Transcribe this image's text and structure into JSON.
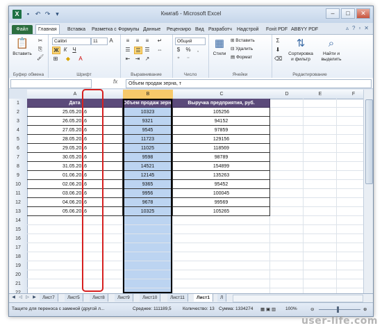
{
  "window": {
    "title": "Книга6 - Microsoft Excel",
    "app_icon": "X"
  },
  "tabs": [
    "Файл",
    "Главная",
    "Вставка",
    "Разметка с",
    "Формулы",
    "Данные",
    "Рецензиро",
    "Вид",
    "Разработч",
    "Надстрой",
    "Foxit PDF",
    "ABBYY PDF"
  ],
  "ribbon": {
    "paste": "Вставить",
    "font_name": "Calibri",
    "font_size": "11",
    "number_format": "Общий",
    "styles": "Стили",
    "insert": "Вставить",
    "delete": "Удалить",
    "format": "Формат",
    "sort_l1": "Сортировка",
    "sort_l2": "и фильтр",
    "find_l1": "Найти и",
    "find_l2": "выделить",
    "groups": {
      "clipboard": "Буфер обмена",
      "font": "Шрифт",
      "alignment": "Выравнивание",
      "number": "Число",
      "cells": "Ячейки",
      "editing": "Редактирование"
    },
    "bold": "Ж",
    "italic": "К",
    "underline": "Ч"
  },
  "formula_bar": {
    "name_box": "",
    "fx": "fx",
    "value": "Объем продаж зерна, т"
  },
  "columns": [
    "A",
    "B",
    "C",
    "D",
    "E",
    "F"
  ],
  "rows": [
    "1",
    "2",
    "3",
    "4",
    "5",
    "6",
    "7",
    "8",
    "9",
    "10",
    "11",
    "12",
    "13",
    "14",
    "15",
    "16",
    "17",
    "18",
    "19",
    "20",
    "21",
    "22",
    "23"
  ],
  "headers": [
    "Дата",
    "Объем продаж зерна, т",
    "Выручка предприятия, руб."
  ],
  "table": [
    [
      "25.05.2016",
      "10323",
      "105256"
    ],
    [
      "26.05.2016",
      "9321",
      "94152"
    ],
    [
      "27.05.2016",
      "9545",
      "97859"
    ],
    [
      "28.05.2016",
      "11723",
      "129156"
    ],
    [
      "29.05.2016",
      "11025",
      "118569"
    ],
    [
      "30.05.2016",
      "9598",
      "98789"
    ],
    [
      "31.05.2016",
      "14521",
      "154899"
    ],
    [
      "01.06.2016",
      "12145",
      "135263"
    ],
    [
      "02.06.2016",
      "9365",
      "95452"
    ],
    [
      "03.06.2016",
      "9956",
      "100045"
    ],
    [
      "04.06.2016",
      "9678",
      "99569"
    ],
    [
      "05.06.2016",
      "10325",
      "105265"
    ]
  ],
  "sheets": [
    "Лист7",
    "Лист5",
    "Лист8",
    "Лист9",
    "Лист10",
    "Лист11",
    "Лист1",
    "Л"
  ],
  "status": {
    "message": "Тащите для переноса с заменой (другой л...",
    "average": "Среднее: 111189,5",
    "count": "Количество: 13",
    "sum": "Сумма: 1334274",
    "zoom": "100%"
  },
  "watermark": "user-life.com"
}
